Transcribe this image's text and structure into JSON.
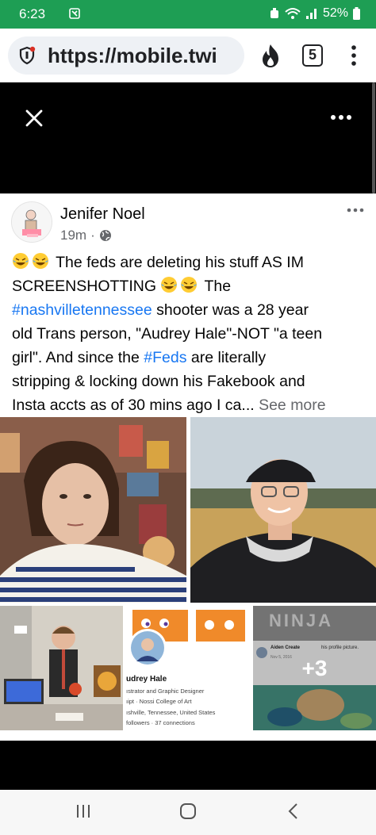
{
  "status_bar": {
    "time": "6:23",
    "battery": "52%",
    "background_color": "#1e9e54"
  },
  "browser": {
    "url": "https://mobile.twi",
    "tab_count": "5",
    "icons": [
      "shield-lock-icon",
      "flame-icon",
      "tabs-icon",
      "overflow-menu-icon"
    ]
  },
  "viewer": {
    "icons": [
      "close-icon",
      "more-horizontal-icon"
    ]
  },
  "post": {
    "author": "Jenifer Noel",
    "time": "19m",
    "separator": "·",
    "audience_icon": "globe-icon",
    "text": {
      "line1_rest": " The feds are deleting his stuff AS IM",
      "line2_start": "SCREENSHOTTING ",
      "line2_rest": " The",
      "hashtag1": "#nashvilletennessee",
      "line3_rest": " shooter was a 28 year",
      "line4": "old Trans person, \"Audrey Hale\"-NOT \"a teen",
      "line5_start": "girl\".  And since the ",
      "hashtag2": "#Feds",
      "line5_rest": " are literally",
      "line6": "stripping & locking down his Fakebook and",
      "line7": "Insta accts as of 30 mins ago I ca...",
      "see_more": " See more"
    },
    "emoji_icon": "laughing-tears-emoji",
    "tag_color": "#1877f2",
    "photos": {
      "profile_card": {
        "name": "udrey Hale",
        "line1": "ıstrator and Graphic Designer",
        "line2": "ıipt · Nossi College of Art",
        "line3": "ıshville, Tennessee, United States",
        "line4": "followers · 37 connections"
      },
      "ninja_caption": "NINJA",
      "comment_author": "Aiden Create",
      "comment_text": "his profile picture.",
      "comment_date": "Nov 5, 2016",
      "more_count": "+3"
    }
  },
  "nav_bar": {
    "icons": [
      "recent-apps-icon",
      "home-icon",
      "back-icon"
    ]
  }
}
